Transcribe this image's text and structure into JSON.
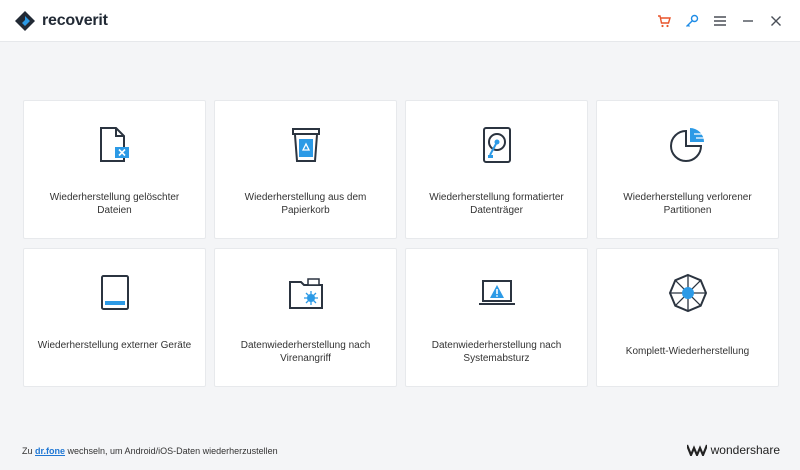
{
  "app": {
    "title": "recoverit",
    "logo_icon": "recoverit-logo-icon"
  },
  "window_controls": [
    {
      "name": "cart-icon",
      "label": "cart",
      "color": "#e8542a"
    },
    {
      "name": "key-icon",
      "label": "register",
      "color": "#1f8ce6"
    },
    {
      "name": "menu-icon",
      "label": "menu",
      "color": "#4a4f57"
    },
    {
      "name": "minimize-icon",
      "label": "minimize",
      "color": "#4a4f57"
    },
    {
      "name": "close-icon",
      "label": "close",
      "color": "#4a4f57"
    }
  ],
  "cards": [
    {
      "id": "deleted-files",
      "icon": "deleted-file-icon",
      "label": "Wiederherstellung gelöschter Dateien"
    },
    {
      "id": "recycle-bin",
      "icon": "recycle-bin-icon",
      "label": "Wiederherstellung aus dem Papierkorb"
    },
    {
      "id": "formatted-drive",
      "icon": "hard-drive-icon",
      "label": "Wiederherstellung formatierter Datenträger"
    },
    {
      "id": "lost-partitions",
      "icon": "partition-icon",
      "label": "Wiederherstellung verlorener Partitionen"
    },
    {
      "id": "external-devices",
      "icon": "external-drive-icon",
      "label": "Wiederherstellung externer Geräte"
    },
    {
      "id": "virus-attack",
      "icon": "virus-folder-icon",
      "label": "Datenwiederherstellung nach Virenangriff"
    },
    {
      "id": "system-crash",
      "icon": "crashed-laptop-icon",
      "label": "Datenwiederherstellung nach Systemabsturz"
    },
    {
      "id": "complete-recovery",
      "icon": "all-round-icon",
      "label": "Komplett-Wiederherstellung"
    }
  ],
  "footer": {
    "prefix": "Zu ",
    "link": "dr.fone",
    "suffix": " wechseln, um Android/iOS-Daten wiederherzustellen"
  },
  "brand": {
    "name": "wondershare",
    "icon": "wondershare-logo-icon"
  },
  "colors": {
    "accent": "#1f8ce6",
    "icon_dark": "#2b3440",
    "icon_blue": "#2c9ae6",
    "background": "#f4f5f7"
  }
}
